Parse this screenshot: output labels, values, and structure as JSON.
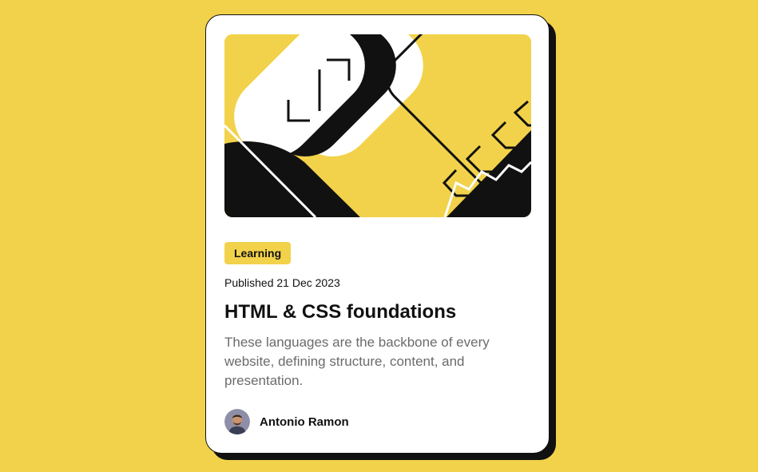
{
  "card": {
    "hero_image": "html-css-foundations-illustration",
    "category": "Learning",
    "published": "Published 21 Dec 2023",
    "title": "HTML & CSS foundations",
    "description": "These languages are the backbone of every website, defining structure, content, and presentation.",
    "author": {
      "name": "Antonio Ramon",
      "avatar": "author-avatar"
    }
  },
  "colors": {
    "background": "#F2D24A",
    "card": "#FFFFFF",
    "ink": "#111111",
    "muted_text": "#6B6B6B",
    "badge": "#F2D24A"
  }
}
